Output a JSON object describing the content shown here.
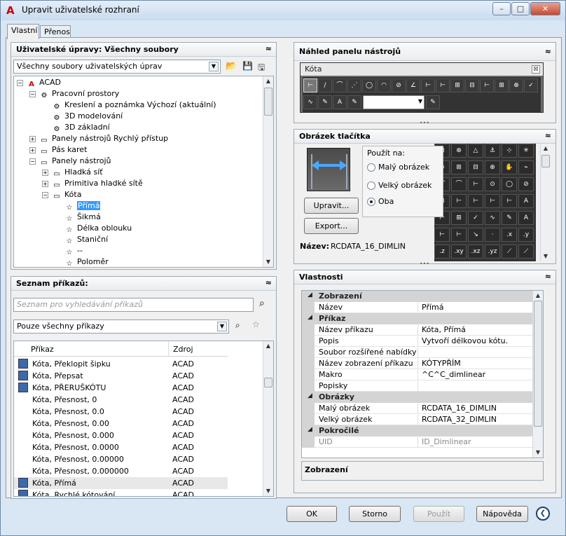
{
  "window": {
    "title": "Upravit uživatelské rozhraní",
    "min": "–",
    "max": "□",
    "close": "✕"
  },
  "tabs": [
    "Vlastní",
    "Přenos"
  ],
  "customizations": {
    "header": "Uživatelské úpravy: Všechny soubory",
    "combo_value": "Všechny soubory uživatelských úprav",
    "tree": [
      {
        "label": "ACAD",
        "level": 0,
        "expander": "−",
        "icon": "A"
      },
      {
        "label": "Pracovní prostory",
        "level": 1,
        "expander": "−",
        "icon": "⚙"
      },
      {
        "label": "Kreslení a poznámka Výchozí (aktuální)",
        "level": 2,
        "expander": "",
        "icon": "⚙"
      },
      {
        "label": "3D modelování",
        "level": 2,
        "expander": "",
        "icon": "⚙"
      },
      {
        "label": "3D základní",
        "level": 2,
        "expander": "",
        "icon": "⚙"
      },
      {
        "label": "Panely nástrojů Rychlý přístup",
        "level": 1,
        "expander": "+",
        "icon": "▭"
      },
      {
        "label": "Pás karet",
        "level": 1,
        "expander": "+",
        "icon": "▭"
      },
      {
        "label": "Panely nástrojů",
        "level": 1,
        "expander": "−",
        "icon": "▭"
      },
      {
        "label": "Hladká síť",
        "level": 2,
        "expander": "+",
        "icon": "▭"
      },
      {
        "label": "Primitiva hladké sítě",
        "level": 2,
        "expander": "+",
        "icon": "▭"
      },
      {
        "label": "Kóta",
        "level": 2,
        "expander": "−",
        "icon": "▭"
      },
      {
        "label": "Přímá",
        "level": 3,
        "expander": "",
        "icon": "☆",
        "selected": true
      },
      {
        "label": "Šikmá",
        "level": 3,
        "expander": "",
        "icon": "☆"
      },
      {
        "label": "Délka oblouku",
        "level": 3,
        "expander": "",
        "icon": "☆"
      },
      {
        "label": "Staniční",
        "level": 3,
        "expander": "",
        "icon": "☆"
      },
      {
        "label": "--",
        "level": 3,
        "expander": "",
        "icon": "☆"
      },
      {
        "label": "Poloměr",
        "level": 3,
        "expander": "",
        "icon": "☆"
      }
    ]
  },
  "commands": {
    "header": "Seznam příkazů:",
    "search_placeholder": "Seznam pro vyhledávání příkazů",
    "filter_value": "Pouze všechny příkazy",
    "col_command": "Příkaz",
    "col_source": "Zdroj",
    "rows": [
      {
        "name": "Kóta, Překlopit šipku",
        "source": "ACAD",
        "icon": true
      },
      {
        "name": "Kóta, Přepsat",
        "source": "ACAD",
        "icon": true
      },
      {
        "name": "Kóta, PŘERUŠKÓTU",
        "source": "ACAD",
        "icon": true
      },
      {
        "name": "Kóta, Přesnost, 0",
        "source": "ACAD",
        "icon": false
      },
      {
        "name": "Kóta, Přesnost, 0.0",
        "source": "ACAD",
        "icon": false
      },
      {
        "name": "Kóta, Přesnost, 0.00",
        "source": "ACAD",
        "icon": false
      },
      {
        "name": "Kóta, Přesnost, 0.000",
        "source": "ACAD",
        "icon": false
      },
      {
        "name": "Kóta, Přesnost, 0.0000",
        "source": "ACAD",
        "icon": false
      },
      {
        "name": "Kóta, Přesnost, 0.00000",
        "source": "ACAD",
        "icon": false
      },
      {
        "name": "Kóta, Přesnost, 0.000000",
        "source": "ACAD",
        "icon": false
      },
      {
        "name": "Kóta, Přímá",
        "source": "ACAD",
        "icon": true
      },
      {
        "name": "Kóta, Rychlé kótování",
        "source": "ACAD",
        "icon": true
      }
    ]
  },
  "toolbar_preview": {
    "header": "Náhled panelu nástrojů",
    "toolbar_title": "Kóta",
    "toolbar_close": "☒"
  },
  "button_image": {
    "header": "Obrázek tlačítka",
    "apply_to_label": "Použít na:",
    "small_label": "Malý obrázek",
    "large_label": "Velký obrázek",
    "both_label": "Oba",
    "selected": "both",
    "edit_button": "Upravit...",
    "export_button": "Export...",
    "name_label": "Název:",
    "name_value": "RCDATA_16_DIMLIN"
  },
  "properties": {
    "header": "Vlastnosti",
    "groups": [
      {
        "title": "Zobrazení",
        "rows": [
          [
            "Název",
            "Přímá"
          ]
        ]
      },
      {
        "title": "Příkaz",
        "rows": [
          [
            "Název příkazu",
            "Kóta, Přímá"
          ],
          [
            "Popis",
            "Vytvoří délkovou kótu."
          ],
          [
            "Soubor rozšířené nabídky",
            ""
          ],
          [
            "Název zobrazení příkazu",
            "KÓTYPŘÍM"
          ],
          [
            "Makro",
            "^C^C_dimlinear"
          ],
          [
            "Popisky",
            ""
          ]
        ]
      },
      {
        "title": "Obrázky",
        "rows": [
          [
            "Malý obrázek",
            "RCDATA_16_DIMLIN"
          ],
          [
            "Velký obrázek",
            "RCDATA_32_DIMLIN"
          ]
        ]
      },
      {
        "title": "Pokročilé",
        "rows": [
          [
            "UID",
            "ID_Dimlinear"
          ]
        ]
      }
    ],
    "description_title": "Zobrazení"
  },
  "footer": {
    "ok": "OK",
    "cancel": "Storno",
    "apply": "Použít",
    "help": "Nápověda",
    "more": "❮"
  },
  "colors": {
    "title_gradient_top": "#e4eef9",
    "selection": "#3399ff",
    "close_button": "#c54b31"
  }
}
